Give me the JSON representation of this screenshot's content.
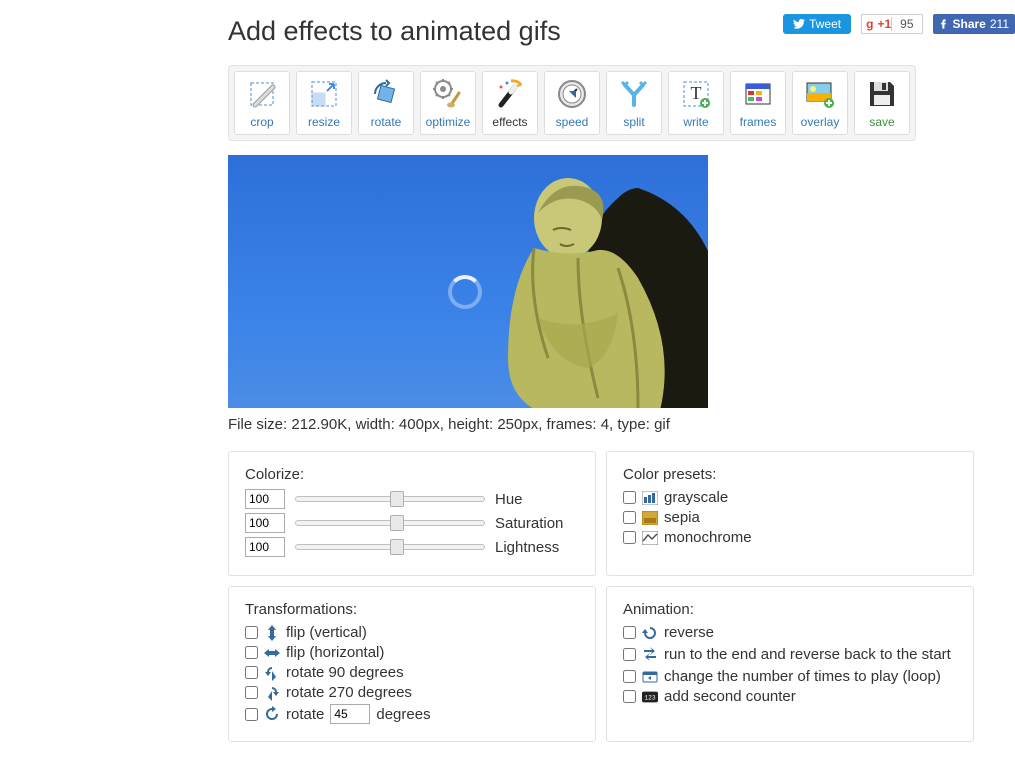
{
  "header": {
    "title": "Add effects to animated gifs",
    "share": {
      "tweet": "Tweet",
      "gplus": "g+1",
      "gplus_count": "95",
      "fb_share": "Share",
      "fb_count": "211"
    }
  },
  "toolbar": [
    {
      "id": "crop",
      "label": "crop"
    },
    {
      "id": "resize",
      "label": "resize"
    },
    {
      "id": "rotate",
      "label": "rotate"
    },
    {
      "id": "optimize",
      "label": "optimize"
    },
    {
      "id": "effects",
      "label": "effects",
      "active": true
    },
    {
      "id": "speed",
      "label": "speed"
    },
    {
      "id": "split",
      "label": "split"
    },
    {
      "id": "write",
      "label": "write"
    },
    {
      "id": "frames",
      "label": "frames"
    },
    {
      "id": "overlay",
      "label": "overlay"
    },
    {
      "id": "save",
      "label": "save"
    }
  ],
  "fileinfo": "File size: 212.90K, width: 400px, height: 250px, frames: 4, type: gif",
  "colorize": {
    "title": "Colorize:",
    "hue": {
      "value": "100",
      "label": "Hue",
      "pos": 50
    },
    "saturation": {
      "value": "100",
      "label": "Saturation",
      "pos": 50
    },
    "lightness": {
      "value": "100",
      "label": "Lightness",
      "pos": 50
    }
  },
  "presets": {
    "title": "Color presets:",
    "items": [
      {
        "id": "grayscale",
        "label": "grayscale"
      },
      {
        "id": "sepia",
        "label": "sepia"
      },
      {
        "id": "monochrome",
        "label": "monochrome"
      }
    ]
  },
  "transformations": {
    "title": "Transformations:",
    "flip_v": "flip (vertical)",
    "flip_h": "flip (horizontal)",
    "rot90": "rotate 90 degrees",
    "rot270": "rotate 270 degrees",
    "rot_custom_pre": "rotate",
    "rot_custom_val": "45",
    "rot_custom_post": "degrees"
  },
  "animation": {
    "title": "Animation:",
    "reverse": "reverse",
    "boomerang": "run to the end and reverse back to the start",
    "loop": "change the number of times to play (loop)",
    "counter": "add second counter"
  }
}
